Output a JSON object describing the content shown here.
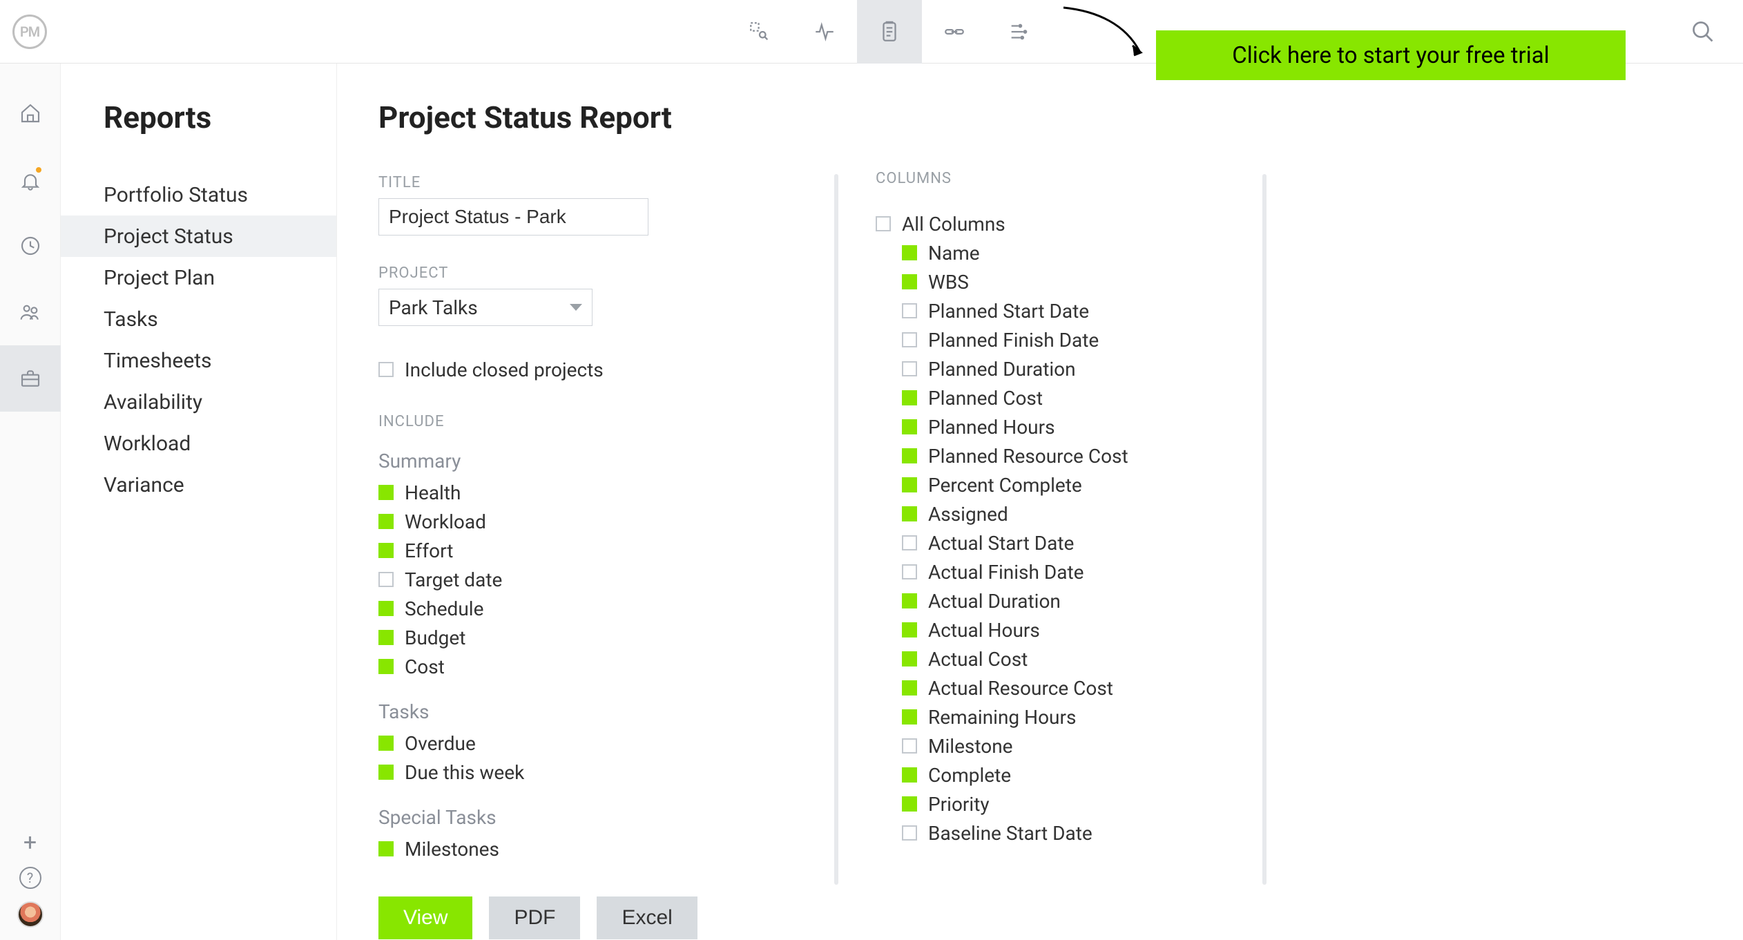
{
  "logo_text": "PM",
  "cta_text": "Click here to start your free trial",
  "sidebar": {
    "title": "Reports",
    "items": [
      {
        "label": "Portfolio Status",
        "active": false
      },
      {
        "label": "Project Status",
        "active": true
      },
      {
        "label": "Project Plan",
        "active": false
      },
      {
        "label": "Tasks",
        "active": false
      },
      {
        "label": "Timesheets",
        "active": false
      },
      {
        "label": "Availability",
        "active": false
      },
      {
        "label": "Workload",
        "active": false
      },
      {
        "label": "Variance",
        "active": false
      }
    ]
  },
  "page": {
    "title": "Project Status Report",
    "title_field_label": "TITLE",
    "title_value": "Project Status - Park",
    "project_field_label": "PROJECT",
    "project_value": "Park Talks",
    "include_closed_label": "Include closed projects",
    "include_closed_checked": false,
    "include_label": "INCLUDE",
    "buttons": {
      "view": "View",
      "pdf": "PDF",
      "excel": "Excel"
    }
  },
  "include_groups": [
    {
      "heading": "Summary",
      "items": [
        {
          "label": "Health",
          "checked": true
        },
        {
          "label": "Workload",
          "checked": true
        },
        {
          "label": "Effort",
          "checked": true
        },
        {
          "label": "Target date",
          "checked": false
        },
        {
          "label": "Schedule",
          "checked": true
        },
        {
          "label": "Budget",
          "checked": true
        },
        {
          "label": "Cost",
          "checked": true
        }
      ]
    },
    {
      "heading": "Tasks",
      "items": [
        {
          "label": "Overdue",
          "checked": true
        },
        {
          "label": "Due this week",
          "checked": true
        }
      ]
    },
    {
      "heading": "Special Tasks",
      "items": [
        {
          "label": "Milestones",
          "checked": true
        }
      ]
    }
  ],
  "columns": {
    "label": "COLUMNS",
    "all_label": "All Columns",
    "all_checked": false,
    "items": [
      {
        "label": "Name",
        "checked": true
      },
      {
        "label": "WBS",
        "checked": true
      },
      {
        "label": "Planned Start Date",
        "checked": false
      },
      {
        "label": "Planned Finish Date",
        "checked": false
      },
      {
        "label": "Planned Duration",
        "checked": false
      },
      {
        "label": "Planned Cost",
        "checked": true
      },
      {
        "label": "Planned Hours",
        "checked": true
      },
      {
        "label": "Planned Resource Cost",
        "checked": true
      },
      {
        "label": "Percent Complete",
        "checked": true
      },
      {
        "label": "Assigned",
        "checked": true
      },
      {
        "label": "Actual Start Date",
        "checked": false
      },
      {
        "label": "Actual Finish Date",
        "checked": false
      },
      {
        "label": "Actual Duration",
        "checked": true
      },
      {
        "label": "Actual Hours",
        "checked": true
      },
      {
        "label": "Actual Cost",
        "checked": true
      },
      {
        "label": "Actual Resource Cost",
        "checked": true
      },
      {
        "label": "Remaining Hours",
        "checked": true
      },
      {
        "label": "Milestone",
        "checked": false
      },
      {
        "label": "Complete",
        "checked": true
      },
      {
        "label": "Priority",
        "checked": true
      },
      {
        "label": "Baseline Start Date",
        "checked": false
      }
    ]
  }
}
